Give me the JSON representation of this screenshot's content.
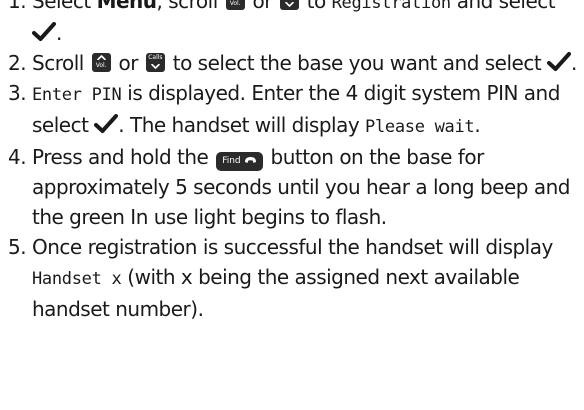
{
  "steps": [
    {
      "number": "1.",
      "segments": [
        {
          "text": "Select "
        },
        {
          "text": "Menu",
          "style": "bold"
        },
        {
          "text": ", scroll "
        },
        {
          "icon": "vol-up-key-icon",
          "label": "Vol."
        },
        {
          "text": " or "
        },
        {
          "icon": "calls-down-key-icon",
          "label": "Calls"
        },
        {
          "text": " to "
        },
        {
          "text": "Registration",
          "style": "lcd"
        },
        {
          "text": " and select "
        },
        {
          "icon": "checkmark-icon"
        },
        {
          "text": "."
        }
      ]
    },
    {
      "number": "2.",
      "segments": [
        {
          "text": "Scroll "
        },
        {
          "icon": "vol-up-key-icon",
          "label": "Vol."
        },
        {
          "text": " or "
        },
        {
          "icon": "calls-down-key-icon",
          "label": "Calls"
        },
        {
          "text": " to select the base you want and select "
        },
        {
          "icon": "checkmark-icon"
        },
        {
          "text": "."
        }
      ]
    },
    {
      "number": "3.",
      "segments": [
        {
          "text": "Enter PIN",
          "style": "lcd"
        },
        {
          "text": " is displayed. Enter the 4 digit system PIN and select "
        },
        {
          "icon": "checkmark-icon"
        },
        {
          "text": ". The handset will display "
        },
        {
          "text": "Please wait",
          "style": "lcd"
        },
        {
          "text": "."
        }
      ]
    },
    {
      "number": "4.",
      "segments": [
        {
          "text": "Press and hold the "
        },
        {
          "icon": "find-button-icon",
          "label": "Find"
        },
        {
          "text": " button on the base for approximately 5 seconds until you hear a long beep and the green In use light begins to flash."
        }
      ]
    },
    {
      "number": "5.",
      "segments": [
        {
          "text": "Once registration is successful the handset will display "
        },
        {
          "text": "Handset x",
          "style": "lcd"
        },
        {
          "text": " (with x being the assigned next available handset number)."
        }
      ]
    }
  ]
}
